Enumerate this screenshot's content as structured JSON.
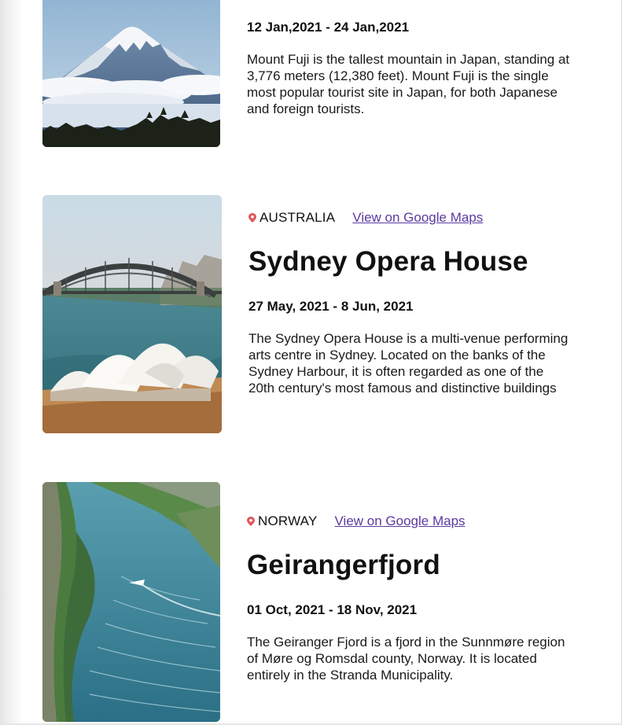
{
  "entries": [
    {
      "dates": "12 Jan,2021 - 24 Jan,2021",
      "description": "Mount Fuji is the tallest mountain in Japan, standing at 3,776 meters (12,380 feet). Mount Fuji is the single most popular tourist site in Japan, for both Japanese and foreign tourists.",
      "image_icon": "mount-fuji-photo"
    },
    {
      "country": "AUSTRALIA",
      "maps_link": "View on Google Maps",
      "title": "Sydney Opera House",
      "dates": "27 May, 2021 - 8 Jun, 2021",
      "description": "The Sydney Opera House is a multi-venue performing arts centre in Sydney. Located on the banks of the Sydney Harbour, it is often regarded as one of the 20th century's most famous and distinctive buildings",
      "image_icon": "sydney-opera-house-photo"
    },
    {
      "country": "NORWAY",
      "maps_link": "View on Google Maps",
      "title": "Geirangerfjord",
      "dates": "01 Oct, 2021 - 18 Nov, 2021",
      "description": "The Geiranger Fjord is a fjord in the Sunnmøre region of Møre og Romsdal county, Norway. It is located entirely in the Stranda Municipality.",
      "image_icon": "geirangerfjord-photo"
    }
  ],
  "colors": {
    "pin": "#e0575b",
    "link": "#5a3aa0",
    "text": "#111111"
  }
}
